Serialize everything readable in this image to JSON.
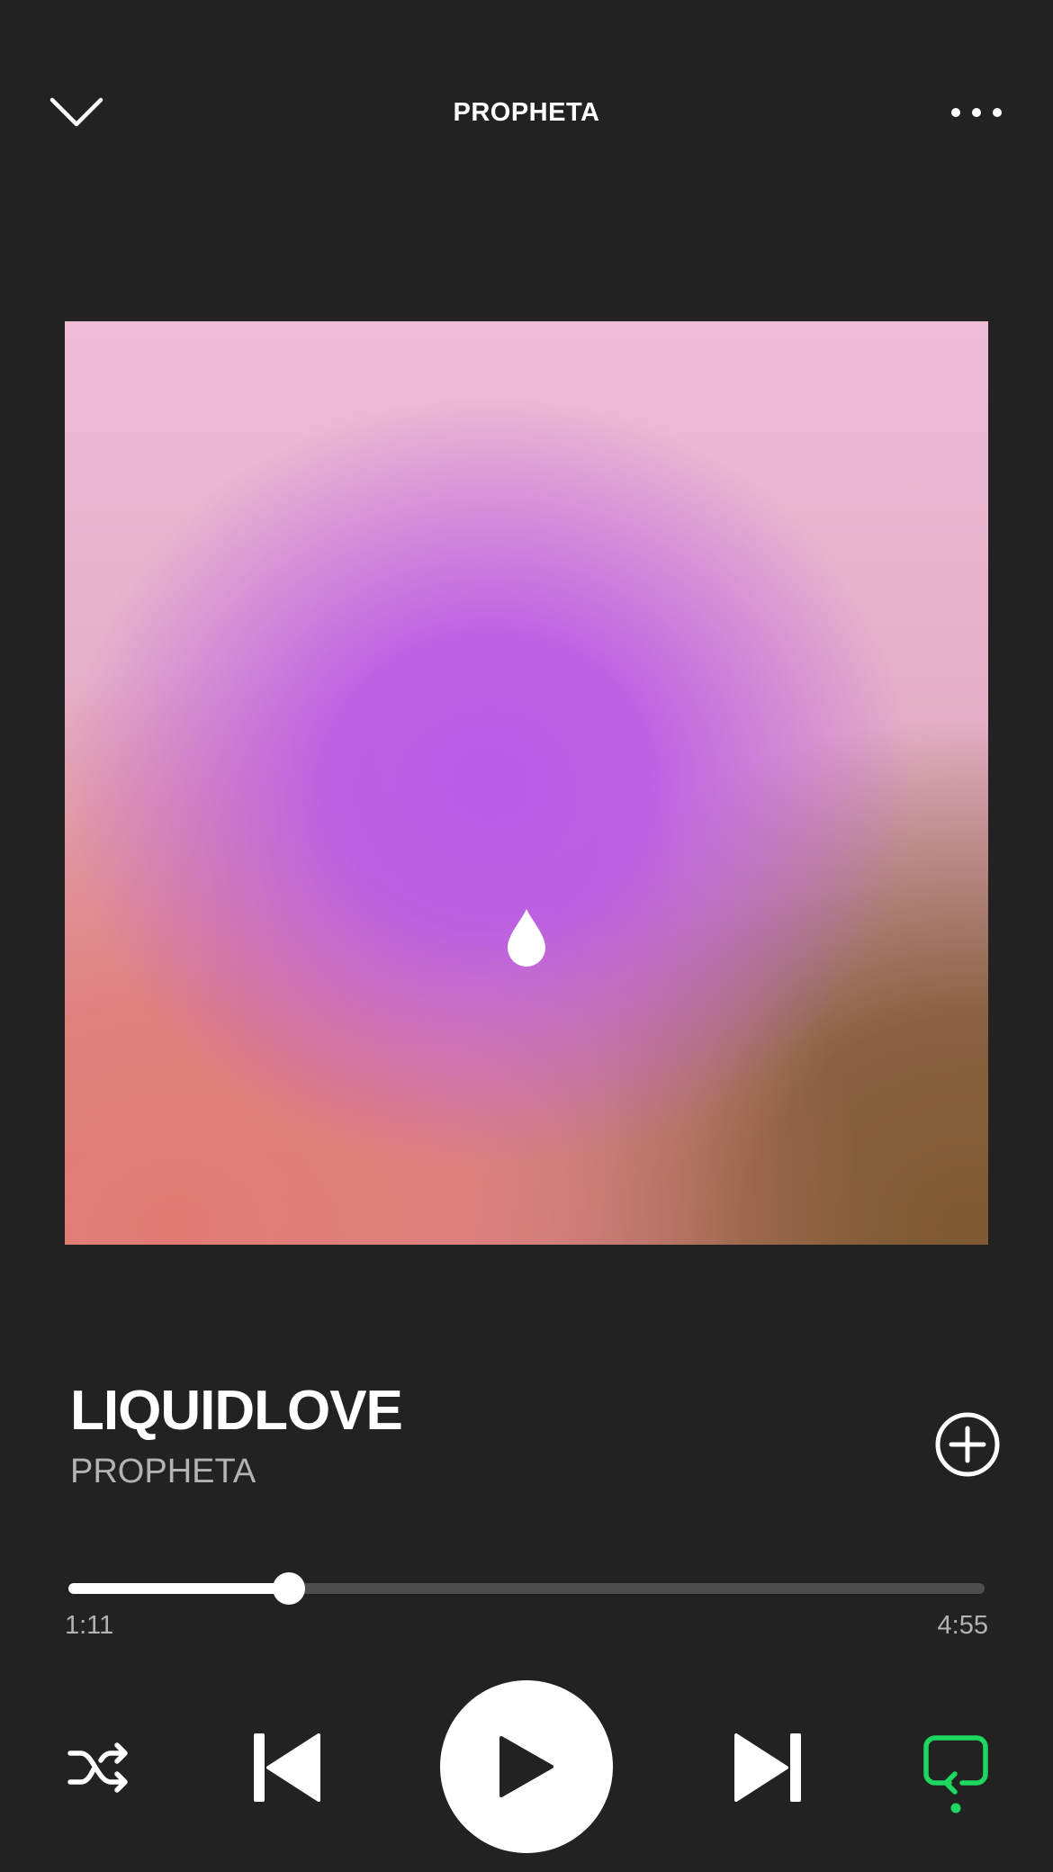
{
  "header": {
    "title": "PROPHETA",
    "collapse_icon": "chevron-down-icon",
    "more_icon": "more-horizontal-icon"
  },
  "artwork": {
    "icon": "water-drop-icon",
    "colors": [
      "#edbdd6",
      "#ba5ce6",
      "#e07c74",
      "#7e5a33"
    ]
  },
  "track": {
    "title": "LIQUIDLOVE",
    "artist": "PROPHETA",
    "add_icon": "plus-circle-icon"
  },
  "progress": {
    "elapsed": "1:11",
    "total": "4:55",
    "fraction": 0.241
  },
  "controls": {
    "shuffle_icon": "shuffle-icon",
    "previous_icon": "skip-previous-icon",
    "play_icon": "play-icon",
    "next_icon": "skip-next-icon",
    "repeat_icon": "repeat-icon",
    "repeat_active": true
  },
  "colors": {
    "background": "#222222",
    "text_primary": "#ffffff",
    "text_secondary": "#b3b3b3",
    "progress_track": "#4d4d4d",
    "accent": "#1ed760"
  }
}
